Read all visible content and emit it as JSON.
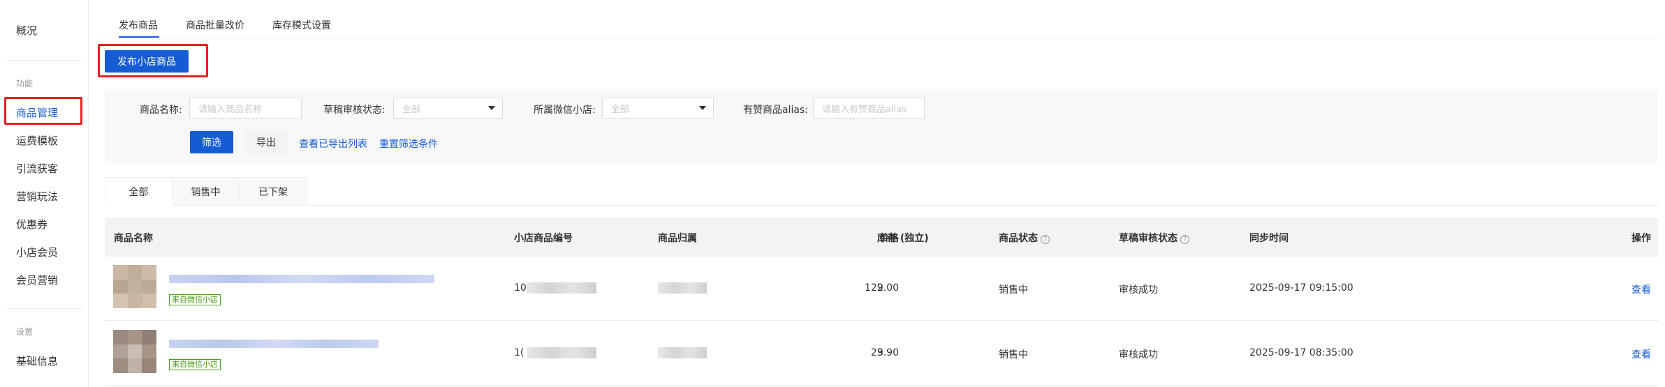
{
  "sidebar": {
    "overview": "概况",
    "group_function": "功能",
    "items": [
      "商品管理",
      "运费模板",
      "引流获客",
      "营销玩法",
      "优惠券",
      "小店会员",
      "会员营销"
    ],
    "group_settings": "设置",
    "settings_items": [
      "基础信息"
    ]
  },
  "top_tabs": [
    "发布商品",
    "商品批量改价",
    "库存模式设置"
  ],
  "publish_button": "发布小店商品",
  "filters": {
    "name_label": "商品名称:",
    "name_placeholder": "请输入商品名称",
    "audit_label": "草稿审核状态:",
    "audit_value": "全部",
    "shop_label": "所属微信小店:",
    "shop_value": "全部",
    "alias_label": "有赞商品alias:",
    "alias_placeholder": "请输入有赞商品alias",
    "filter_button": "筛选",
    "export_button": "导出",
    "view_exports_link": "查看已导出列表",
    "reset_link": "重置筛选条件"
  },
  "status_tabs": [
    "全部",
    "销售中",
    "已下架"
  ],
  "table": {
    "headers": {
      "name": "商品名称",
      "code": "小店商品编号",
      "owner": "商品归属",
      "price": "价格",
      "stock": "库存 (独立)",
      "status": "商品状态",
      "audit": "草稿审核状态",
      "sync": "同步时间",
      "action": "操作"
    },
    "rows": [
      {
        "source_tag": "来自微信小店",
        "code_prefix": "10",
        "price": "129.00",
        "stock": "2",
        "status": "销售中",
        "audit": "审核成功",
        "sync": "2025-09-17 09:15:00",
        "action": "查看"
      },
      {
        "source_tag": "来自微信小店",
        "code_prefix": "1(",
        "price": "29.90",
        "stock": "3",
        "status": "销售中",
        "audit": "审核成功",
        "sync": "2025-09-17 08:35:00",
        "action": "查看"
      }
    ]
  },
  "colors": {
    "primary": "#155bd4",
    "highlight": "#e62121",
    "tag_green": "#45a110"
  }
}
